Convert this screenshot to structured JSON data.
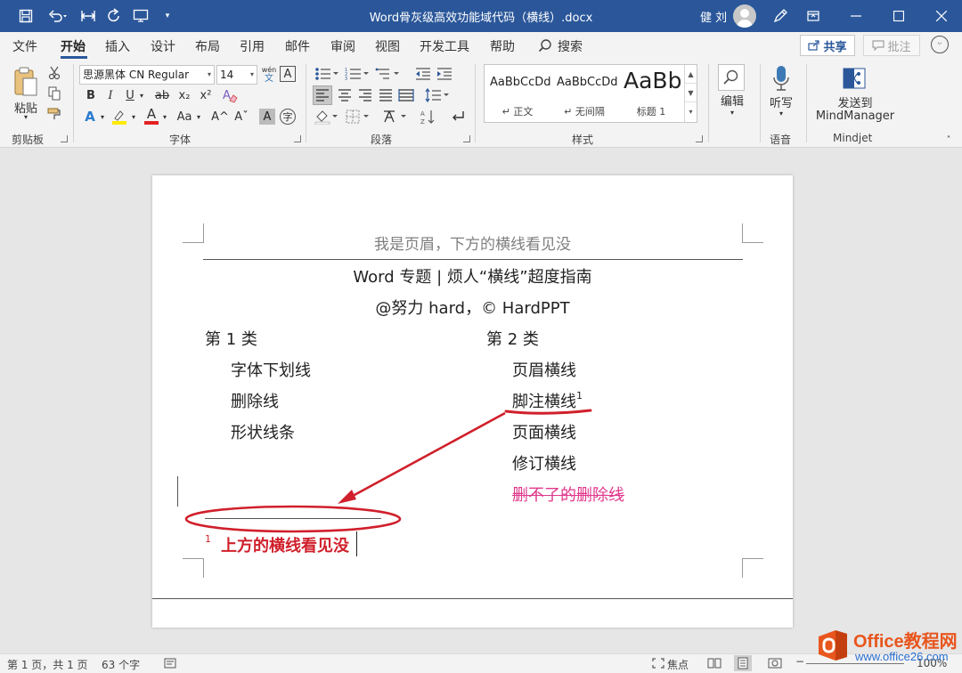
{
  "titlebar": {
    "doc_title": "Word骨灰级高效功能域代码（横线）.docx",
    "user": "健 刘",
    "qat": {
      "save": "save-icon",
      "undo": "undo-icon",
      "redo": "redo-icon",
      "customize": "customize-icon"
    }
  },
  "tabs": [
    "文件",
    "开始",
    "插入",
    "设计",
    "布局",
    "引用",
    "邮件",
    "审阅",
    "视图",
    "开发工具",
    "帮助",
    "搜索"
  ],
  "share_label": "共享",
  "comment_label": "批注",
  "ribbon": {
    "clipboard": {
      "paste": "粘贴",
      "label": "剪贴板"
    },
    "font": {
      "name": "思源黑体 CN Regular",
      "size": "14",
      "label": "字体",
      "bold": "B",
      "italic": "I",
      "underline": "U",
      "strike": "ab",
      "sub": "x₂",
      "sup": "x²",
      "clear": "A",
      "highlight": "ab",
      "color": "A",
      "aa": "Aa",
      "grow": "A^",
      "shrink": "Aˇ",
      "shade": "A",
      "enclose": "字",
      "wen": "wén",
      "wen_zh": "文"
    },
    "paragraph": {
      "label": "段落"
    },
    "styles": {
      "label": "样式",
      "items": [
        {
          "sample": "AaBbCcDd",
          "name": "↵ 正文"
        },
        {
          "sample": "AaBbCcDd",
          "name": "↵ 无间隔"
        },
        {
          "sample": "AaBb",
          "name": "标题 1"
        }
      ]
    },
    "edit": {
      "label": "编辑"
    },
    "voice": {
      "dictate": "听写",
      "label": "语音"
    },
    "mindjet": {
      "send": "发送到",
      "send2": "MindManager",
      "label": "Mindjet"
    }
  },
  "document": {
    "header": "我是页眉，下方的横线看见没",
    "title": "Word 专题 | 烦人“横线”超度指南",
    "subtitle": "@努力 hard，© HardPPT",
    "col1": {
      "heading": "第 1 类",
      "items": [
        "字体下划线",
        "删除线",
        "形状线条"
      ]
    },
    "col2": {
      "heading": "第 2 类",
      "items": [
        "页眉横线",
        "脚注横线",
        "页面横线",
        "修订横线"
      ],
      "pink": "删不了的删除线"
    },
    "footnote_ref": "1",
    "footnote_num": "1",
    "footnote_text": "上方的横线看见没"
  },
  "colors": {
    "accent": "#2b579a",
    "annotation": "#d0202b",
    "pink": "#e0388c"
  },
  "status": {
    "page": "第 1 页，共 1 页",
    "words": "63 个字",
    "focus": "焦点",
    "zoom": "100%"
  },
  "watermark": {
    "brand": "Office教程网",
    "url": "www.office26.com"
  }
}
